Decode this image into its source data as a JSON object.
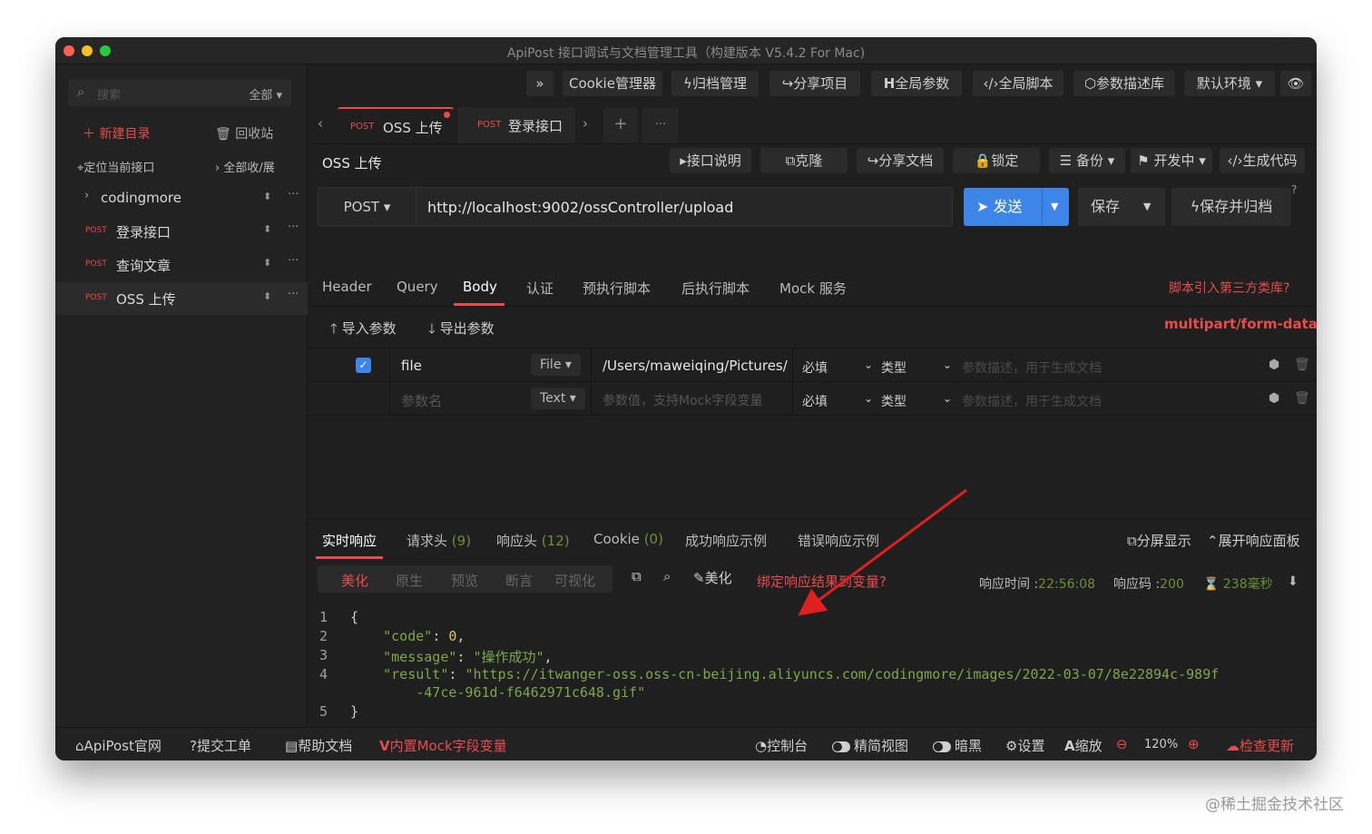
{
  "window": {
    "title": "ApiPost 接口调试与文档管理工具（构建版本 V5.4.2 For Mac)"
  },
  "sidebar": {
    "search_placeholder": "搜索",
    "filter": "全部",
    "new_dir": "新建目录",
    "trash": "回收站",
    "locate": "定位当前接口",
    "expand_all": "全部收/展",
    "items": [
      {
        "kind": "folder",
        "label": "codingmore"
      },
      {
        "kind": "api",
        "method": "POST",
        "label": "登录接口"
      },
      {
        "kind": "api",
        "method": "POST",
        "label": "查询文章"
      },
      {
        "kind": "api",
        "method": "POST",
        "label": "OSS 上传"
      }
    ]
  },
  "toolbar": {
    "more": "»",
    "cookie": "Cookie管理器",
    "archive": "归档管理",
    "share_project": "分享项目",
    "global_params": "全局参数",
    "global_script": "全局脚本",
    "param_lib": "参数描述库",
    "env": "默认环境",
    "eye": "👁"
  },
  "tabs": {
    "prev": "‹",
    "next": "›",
    "add": "+",
    "more": "···",
    "items": [
      {
        "method": "POST",
        "label": "OSS 上传"
      },
      {
        "method": "POST",
        "label": "登录接口"
      }
    ]
  },
  "api": {
    "title": "OSS 上传",
    "doc": "接口说明",
    "clone": "克隆",
    "share_doc": "分享文档",
    "lock": "锁定",
    "backup": "备份",
    "status": "开发中",
    "gen_code": "生成代码",
    "method": "POST",
    "url": "http://localhost:9002/ossController/upload",
    "send": "发送",
    "save": "保存",
    "save_archive": "保存并归档",
    "help": "?"
  },
  "subtabs": {
    "items": [
      "Header",
      "Query",
      "Body",
      "认证",
      "预执行脚本",
      "后执行脚本",
      "Mock 服务"
    ],
    "active": "Body",
    "third_lib": "脚本引入第三方类库?"
  },
  "params": {
    "import": "导入参数",
    "export": "导出参数",
    "content_type": "multipart/form-data",
    "rows": [
      {
        "name": "file",
        "type": "File",
        "value": "/Users/maweiqing/Pictures/",
        "required": "必填",
        "kind": "类型",
        "desc": "参数描述，用于生成文档"
      },
      {
        "name": "参数名",
        "type": "Text",
        "value": "参数值，支持Mock字段变量",
        "required": "必填",
        "kind": "类型",
        "desc": "参数描述，用于生成文档"
      }
    ]
  },
  "response": {
    "tabs": {
      "realtime": "实时响应",
      "req_headers": "请求头",
      "req_headers_count": "(9)",
      "resp_headers": "响应头",
      "resp_headers_count": "(12)",
      "cookie": "Cookie",
      "cookie_count": "(0)",
      "success_example": "成功响应示例",
      "error_example": "错误响应示例",
      "split": "分屏显示",
      "expand": "展开响应面板"
    },
    "formats": [
      "美化",
      "原生",
      "预览",
      "断言",
      "可视化"
    ],
    "beautify": "美化",
    "bind_var": "绑定响应结果到变量?",
    "time_label": "响应时间 :",
    "time_value": "22:56:08",
    "code_label": "响应码 :",
    "code_value": "200",
    "duration": "238毫秒",
    "lines": {
      "n1": "1",
      "n2": "2",
      "n3": "3",
      "n4": "4",
      "n5": "5",
      "open": "{",
      "code_key": "\"code\"",
      "code_val": "0",
      "message_key": "\"message\"",
      "message_val": "\"操作成功\"",
      "result_key": "\"result\"",
      "result_val_1": "\"https://itwanger-oss.oss-cn-beijing.aliyuncs.com/codingmore/images/2022-03-07/8e22894c-989f",
      "result_val_2": "-47ce-961d-f6462971c648.gif\"",
      "close": "}"
    }
  },
  "footer": {
    "site": "ApiPost官网",
    "ticket": "提交工单",
    "help": "帮助文档",
    "mock": "内置Mock字段变量",
    "console": "控制台",
    "simple_view": "精简视图",
    "dark": "暗黑",
    "settings": "设置",
    "zoom": "缩放",
    "zoom_value": "120%",
    "update": "检查更新"
  },
  "watermark": "@稀土掘金技术社区",
  "colors": {
    "accent": "#e84b4b",
    "primary": "#3d86e8",
    "bg": "#1f1f1f"
  }
}
